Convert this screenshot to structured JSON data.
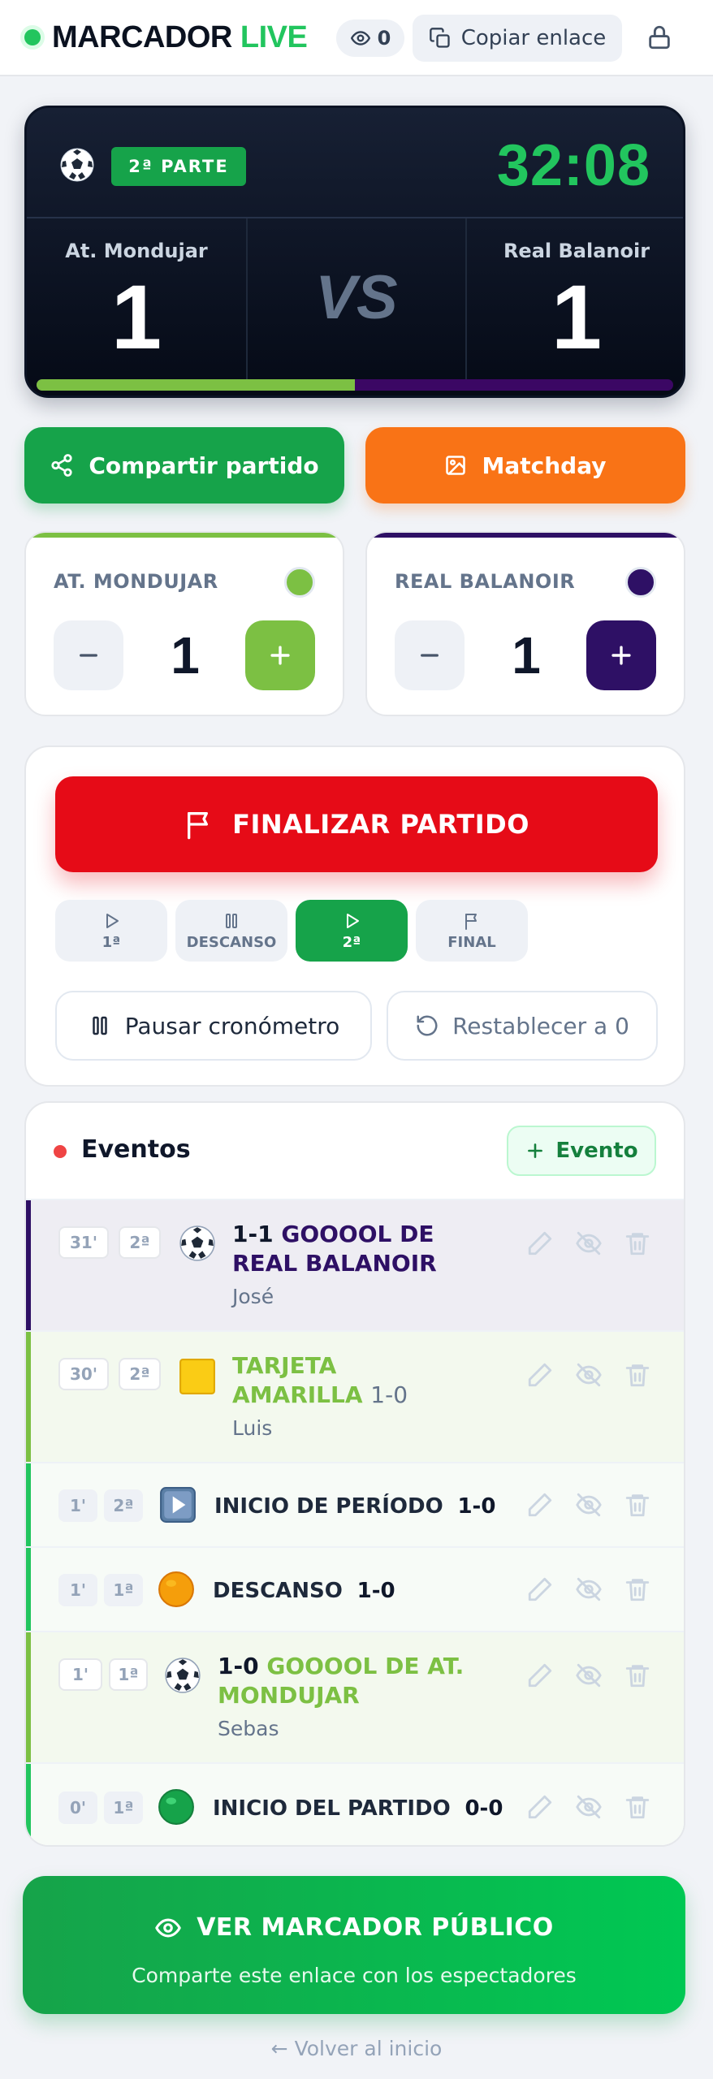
{
  "header": {
    "brand_main": "MARCADOR",
    "brand_accent": "LIVE",
    "viewers_count": "0",
    "copy_link_label": "Copiar enlace",
    "icons": [
      "live-dot",
      "eye-icon",
      "copy-icon",
      "lock-icon"
    ]
  },
  "scoreboard": {
    "period_badge": "2ª PARTE",
    "clock": "32:08",
    "home_name": "At. Mondujar",
    "away_name": "Real Balanoir",
    "home_score": "1",
    "away_score": "1",
    "vs_label": "VS",
    "progress_fraction": 0.5,
    "colors": {
      "progress_home": "#7cc043",
      "progress_away": "#3b0764",
      "clock": "#22c55e"
    }
  },
  "actions": {
    "share_label": "Compartir partido",
    "matchday_label": "Matchday"
  },
  "teams": {
    "home": {
      "name": "AT. MONDUJAR",
      "count": "1",
      "color": "#7cc043"
    },
    "away": {
      "name": "REAL BALANOIR",
      "count": "1",
      "color": "#2e1065"
    }
  },
  "controls": {
    "end_label": "FINALIZAR PARTIDO",
    "phases": [
      {
        "label": "1ª",
        "icon": "play-icon",
        "active": false
      },
      {
        "label": "DESCANSO",
        "icon": "pause-icon",
        "active": false
      },
      {
        "label": "2ª",
        "icon": "play-icon",
        "active": true
      },
      {
        "label": "FINAL",
        "icon": "flag-icon",
        "active": false
      }
    ],
    "pause_label": "Pausar cronómetro",
    "reset_label": "Restablecer a 0"
  },
  "events": {
    "title": "Eventos",
    "add_label": "Evento",
    "items": [
      {
        "minute": "31'",
        "period": "2ª",
        "icon": "soccer-ball-icon",
        "score": "1-1",
        "text": "GOOOOL DE REAL BALANOIR",
        "player": "José"
      },
      {
        "minute": "30'",
        "period": "2ª",
        "icon": "yellow-card-icon",
        "text": "TARJETA AMARILLA",
        "score": "1-0",
        "player": "Luis"
      },
      {
        "minute": "1'",
        "period": "2ª",
        "icon": "play-button-icon",
        "text": "INICIO DE PERÍODO",
        "score": "1-0"
      },
      {
        "minute": "1'",
        "period": "1ª",
        "icon": "orange-circle-icon",
        "text": "DESCANSO",
        "score": "1-0"
      },
      {
        "minute": "1'",
        "period": "1ª",
        "icon": "soccer-ball-icon",
        "score": "1-0",
        "text": "GOOOOL DE AT. MONDUJAR",
        "player": "Sebas"
      },
      {
        "minute": "0'",
        "period": "1ª",
        "icon": "green-circle-icon",
        "text": "INICIO DEL PARTIDO",
        "score": "0-0"
      }
    ]
  },
  "public_view": {
    "label": "VER MARCADOR PÚBLICO",
    "subtitle": "Comparte este enlace con los espectadores"
  },
  "footer": {
    "back_label": "← Volver al inicio"
  }
}
